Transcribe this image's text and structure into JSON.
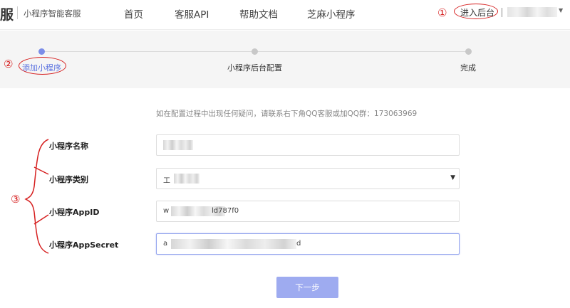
{
  "header": {
    "logo_mark": "服",
    "logo_text": "小程序智能客服",
    "nav": [
      "首页",
      "客服API",
      "帮助文档",
      "芝麻小程序"
    ],
    "enter_admin": "进入后台"
  },
  "steps": [
    "添加小程序",
    "小程序后台配置",
    "完成"
  ],
  "annotations": [
    "①",
    "②",
    "③"
  ],
  "form": {
    "hint": "如在配置过程中出现任何疑问，请联系右下角QQ客服或加QQ群：173063969",
    "fields": [
      {
        "label": "小程序名称",
        "value": ""
      },
      {
        "label": "小程序类别",
        "value": "工"
      },
      {
        "label": "小程序AppID",
        "value_prefix": "w",
        "value_suffix": "ld787f0"
      },
      {
        "label": "小程序AppSecret",
        "value_prefix": "a",
        "value_suffix": "d"
      }
    ],
    "next_button": "下一步"
  },
  "colors": {
    "accent": "#7b8de8",
    "button": "#9eabf0",
    "annotation": "#d62020"
  }
}
